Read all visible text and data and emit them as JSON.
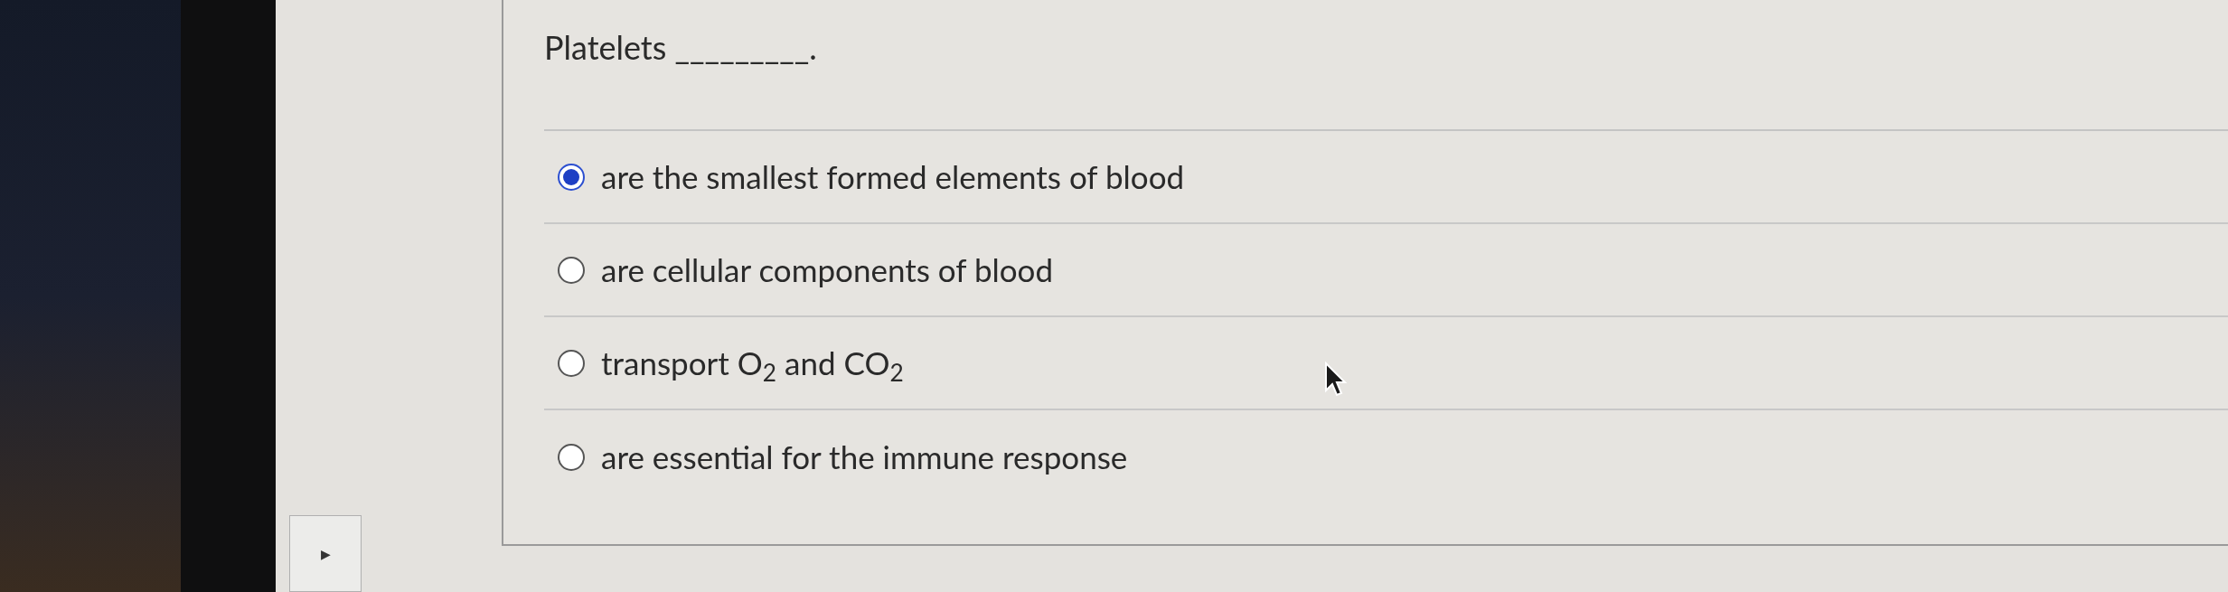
{
  "question": {
    "text": "Platelets _________."
  },
  "options": [
    {
      "label": "are the smallest formed elements of blood",
      "selected": true
    },
    {
      "label": "are cellular components of blood",
      "selected": false
    },
    {
      "label": "transport O$_{2}$ and CO$_{2}$",
      "selected": false
    },
    {
      "label": "are essential for the immune response",
      "selected": false
    }
  ],
  "side_button": {
    "icon": "▶"
  }
}
